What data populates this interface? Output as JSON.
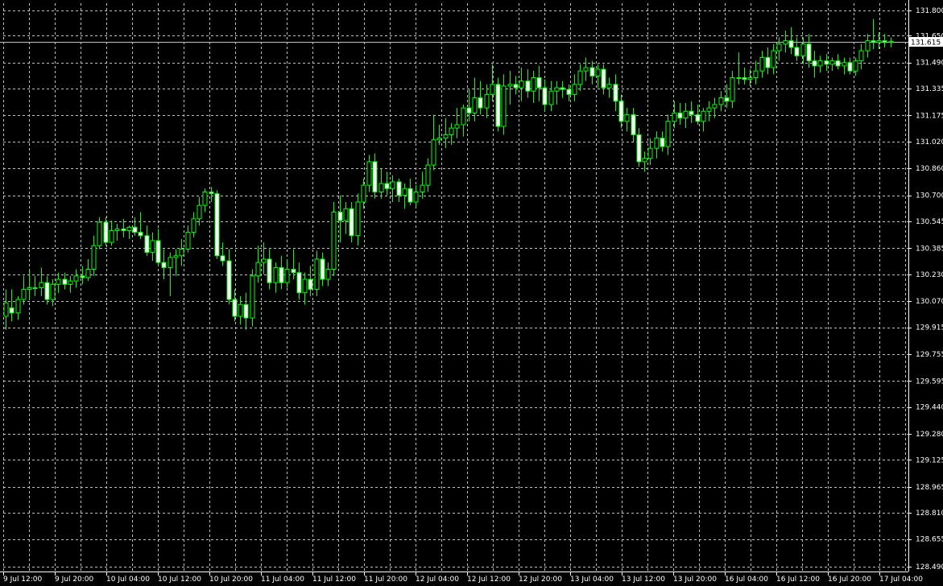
{
  "colors": {
    "background": "#000000",
    "grid": "#c0c0c0",
    "axis": "#ffffff",
    "bull_body": "#000000",
    "bull_outline": "#00ff00",
    "bear_body": "#ffffff",
    "bear_outline": "#00ff00",
    "wick": "#00ff00",
    "current_price_line": "#c0c0c0",
    "current_price_box": "#ffffff"
  },
  "chart_data": {
    "type": "candlestick",
    "grid": true,
    "ylim": [
      128.45,
      131.87
    ],
    "y_ticks": [
      "131.800",
      "131.650",
      "131.490",
      "131.335",
      "131.175",
      "131.020",
      "130.860",
      "130.700",
      "130.545",
      "130.385",
      "130.230",
      "130.070",
      "129.915",
      "129.755",
      "129.595",
      "129.440",
      "129.280",
      "129.125",
      "128.965",
      "128.810",
      "128.655",
      "128.490"
    ],
    "x_ticks": [
      "9 Jul 12:00",
      "9 Jul 20:00",
      "10 Jul 04:00",
      "10 Jul 12:00",
      "10 Jul 20:00",
      "11 Jul 04:00",
      "11 Jul 12:00",
      "11 Jul 20:00",
      "12 Jul 04:00",
      "12 Jul 12:00",
      "12 Jul 20:00",
      "13 Jul 04:00",
      "13 Jul 12:00",
      "13 Jul 20:00",
      "16 Jul 04:00",
      "16 Jul 12:00",
      "16 Jul 20:00",
      "17 Jul 04:00"
    ],
    "current_price": "131.615",
    "current_price_value": 131.615,
    "x_tick_every": 4,
    "candles": [
      {
        "o": 129.98,
        "h": 130.14,
        "l": 129.9,
        "c": 130.06
      },
      {
        "o": 130.03,
        "h": 130.14,
        "l": 129.95,
        "c": 130.0
      },
      {
        "o": 130.0,
        "h": 130.1,
        "l": 129.96,
        "c": 130.08
      },
      {
        "o": 130.08,
        "h": 130.22,
        "l": 130.05,
        "c": 130.14
      },
      {
        "o": 130.14,
        "h": 130.25,
        "l": 130.08,
        "c": 130.15
      },
      {
        "o": 130.15,
        "h": 130.22,
        "l": 130.1,
        "c": 130.15
      },
      {
        "o": 130.15,
        "h": 130.27,
        "l": 130.1,
        "c": 130.18
      },
      {
        "o": 130.18,
        "h": 130.22,
        "l": 130.05,
        "c": 130.08
      },
      {
        "o": 130.08,
        "h": 130.2,
        "l": 130.04,
        "c": 130.17
      },
      {
        "o": 130.17,
        "h": 130.24,
        "l": 130.12,
        "c": 130.2
      },
      {
        "o": 130.2,
        "h": 130.24,
        "l": 130.14,
        "c": 130.17
      },
      {
        "o": 130.17,
        "h": 130.22,
        "l": 130.12,
        "c": 130.19
      },
      {
        "o": 130.19,
        "h": 130.26,
        "l": 130.15,
        "c": 130.22
      },
      {
        "o": 130.22,
        "h": 130.28,
        "l": 130.17,
        "c": 130.21
      },
      {
        "o": 130.21,
        "h": 130.32,
        "l": 130.19,
        "c": 130.26
      },
      {
        "o": 130.26,
        "h": 130.46,
        "l": 130.22,
        "c": 130.4
      },
      {
        "o": 130.4,
        "h": 130.57,
        "l": 130.38,
        "c": 130.54
      },
      {
        "o": 130.54,
        "h": 130.57,
        "l": 130.4,
        "c": 130.42
      },
      {
        "o": 130.42,
        "h": 130.55,
        "l": 130.4,
        "c": 130.49
      },
      {
        "o": 130.49,
        "h": 130.53,
        "l": 130.43,
        "c": 130.5
      },
      {
        "o": 130.5,
        "h": 130.56,
        "l": 130.45,
        "c": 130.49
      },
      {
        "o": 130.49,
        "h": 130.52,
        "l": 130.44,
        "c": 130.51
      },
      {
        "o": 130.51,
        "h": 130.57,
        "l": 130.46,
        "c": 130.48
      },
      {
        "o": 130.48,
        "h": 130.6,
        "l": 130.44,
        "c": 130.46
      },
      {
        "o": 130.46,
        "h": 130.52,
        "l": 130.34,
        "c": 130.36
      },
      {
        "o": 130.36,
        "h": 130.48,
        "l": 130.31,
        "c": 130.43
      },
      {
        "o": 130.43,
        "h": 130.5,
        "l": 130.28,
        "c": 130.3
      },
      {
        "o": 130.3,
        "h": 130.38,
        "l": 130.2,
        "c": 130.27
      },
      {
        "o": 130.27,
        "h": 130.36,
        "l": 130.1,
        "c": 130.33
      },
      {
        "o": 130.33,
        "h": 130.38,
        "l": 130.22,
        "c": 130.34
      },
      {
        "o": 130.34,
        "h": 130.44,
        "l": 130.28,
        "c": 130.38
      },
      {
        "o": 130.38,
        "h": 130.52,
        "l": 130.36,
        "c": 130.48
      },
      {
        "o": 130.48,
        "h": 130.6,
        "l": 130.45,
        "c": 130.56
      },
      {
        "o": 130.56,
        "h": 130.69,
        "l": 130.52,
        "c": 130.64
      },
      {
        "o": 130.64,
        "h": 130.74,
        "l": 130.6,
        "c": 130.72
      },
      {
        "o": 130.72,
        "h": 130.75,
        "l": 130.66,
        "c": 130.71
      },
      {
        "o": 130.71,
        "h": 130.73,
        "l": 130.32,
        "c": 130.34
      },
      {
        "o": 130.34,
        "h": 130.42,
        "l": 130.28,
        "c": 130.31
      },
      {
        "o": 130.31,
        "h": 130.38,
        "l": 130.05,
        "c": 130.08
      },
      {
        "o": 130.08,
        "h": 130.14,
        "l": 129.95,
        "c": 129.98
      },
      {
        "o": 129.98,
        "h": 130.1,
        "l": 129.93,
        "c": 130.05
      },
      {
        "o": 130.05,
        "h": 130.12,
        "l": 129.9,
        "c": 129.97
      },
      {
        "o": 129.97,
        "h": 130.26,
        "l": 129.92,
        "c": 130.22
      },
      {
        "o": 130.22,
        "h": 130.4,
        "l": 130.18,
        "c": 130.3
      },
      {
        "o": 130.3,
        "h": 130.42,
        "l": 130.23,
        "c": 130.32
      },
      {
        "o": 130.32,
        "h": 130.38,
        "l": 130.14,
        "c": 130.18
      },
      {
        "o": 130.18,
        "h": 130.3,
        "l": 130.12,
        "c": 130.27
      },
      {
        "o": 130.27,
        "h": 130.34,
        "l": 130.14,
        "c": 130.18
      },
      {
        "o": 130.18,
        "h": 130.32,
        "l": 130.15,
        "c": 130.26
      },
      {
        "o": 130.26,
        "h": 130.38,
        "l": 130.2,
        "c": 130.24
      },
      {
        "o": 130.24,
        "h": 130.3,
        "l": 130.08,
        "c": 130.12
      },
      {
        "o": 130.12,
        "h": 130.24,
        "l": 130.05,
        "c": 130.2
      },
      {
        "o": 130.2,
        "h": 130.28,
        "l": 130.1,
        "c": 130.14
      },
      {
        "o": 130.14,
        "h": 130.37,
        "l": 130.1,
        "c": 130.32
      },
      {
        "o": 130.32,
        "h": 130.36,
        "l": 130.16,
        "c": 130.2
      },
      {
        "o": 130.2,
        "h": 130.3,
        "l": 130.16,
        "c": 130.26
      },
      {
        "o": 130.26,
        "h": 130.66,
        "l": 130.22,
        "c": 130.6
      },
      {
        "o": 130.6,
        "h": 130.7,
        "l": 130.42,
        "c": 130.55
      },
      {
        "o": 130.55,
        "h": 130.66,
        "l": 130.47,
        "c": 130.62
      },
      {
        "o": 130.62,
        "h": 130.66,
        "l": 130.42,
        "c": 130.46
      },
      {
        "o": 130.46,
        "h": 130.71,
        "l": 130.4,
        "c": 130.66
      },
      {
        "o": 130.66,
        "h": 130.8,
        "l": 130.62,
        "c": 130.76
      },
      {
        "o": 130.76,
        "h": 130.94,
        "l": 130.72,
        "c": 130.9
      },
      {
        "o": 130.9,
        "h": 130.95,
        "l": 130.68,
        "c": 130.72
      },
      {
        "o": 130.72,
        "h": 130.86,
        "l": 130.68,
        "c": 130.77
      },
      {
        "o": 130.77,
        "h": 130.84,
        "l": 130.7,
        "c": 130.74
      },
      {
        "o": 130.74,
        "h": 130.82,
        "l": 130.66,
        "c": 130.78
      },
      {
        "o": 130.78,
        "h": 130.8,
        "l": 130.66,
        "c": 130.7
      },
      {
        "o": 130.7,
        "h": 130.77,
        "l": 130.62,
        "c": 130.74
      },
      {
        "o": 130.74,
        "h": 130.8,
        "l": 130.64,
        "c": 130.66
      },
      {
        "o": 130.66,
        "h": 130.76,
        "l": 130.63,
        "c": 130.72
      },
      {
        "o": 130.72,
        "h": 130.84,
        "l": 130.68,
        "c": 130.76
      },
      {
        "o": 130.76,
        "h": 130.92,
        "l": 130.72,
        "c": 130.88
      },
      {
        "o": 130.88,
        "h": 131.18,
        "l": 130.85,
        "c": 131.03
      },
      {
        "o": 131.03,
        "h": 131.12,
        "l": 131.0,
        "c": 131.04
      },
      {
        "o": 131.04,
        "h": 131.16,
        "l": 130.98,
        "c": 131.06
      },
      {
        "o": 131.06,
        "h": 131.13,
        "l": 131.0,
        "c": 131.1
      },
      {
        "o": 131.1,
        "h": 131.22,
        "l": 131.04,
        "c": 131.12
      },
      {
        "o": 131.12,
        "h": 131.24,
        "l": 131.05,
        "c": 131.22
      },
      {
        "o": 131.22,
        "h": 131.33,
        "l": 131.14,
        "c": 131.19
      },
      {
        "o": 131.19,
        "h": 131.4,
        "l": 131.14,
        "c": 131.28
      },
      {
        "o": 131.28,
        "h": 131.38,
        "l": 131.18,
        "c": 131.22
      },
      {
        "o": 131.22,
        "h": 131.36,
        "l": 131.16,
        "c": 131.3
      },
      {
        "o": 131.3,
        "h": 131.48,
        "l": 131.26,
        "c": 131.36
      },
      {
        "o": 131.36,
        "h": 131.4,
        "l": 131.08,
        "c": 131.11
      },
      {
        "o": 131.11,
        "h": 131.42,
        "l": 131.06,
        "c": 131.35
      },
      {
        "o": 131.35,
        "h": 131.44,
        "l": 131.24,
        "c": 131.36
      },
      {
        "o": 131.36,
        "h": 131.41,
        "l": 131.3,
        "c": 131.34
      },
      {
        "o": 131.34,
        "h": 131.46,
        "l": 131.26,
        "c": 131.38
      },
      {
        "o": 131.38,
        "h": 131.45,
        "l": 131.28,
        "c": 131.32
      },
      {
        "o": 131.32,
        "h": 131.44,
        "l": 131.25,
        "c": 131.4
      },
      {
        "o": 131.4,
        "h": 131.47,
        "l": 131.26,
        "c": 131.34
      },
      {
        "o": 131.34,
        "h": 131.39,
        "l": 131.2,
        "c": 131.24
      },
      {
        "o": 131.24,
        "h": 131.38,
        "l": 131.2,
        "c": 131.32
      },
      {
        "o": 131.32,
        "h": 131.38,
        "l": 131.24,
        "c": 131.34
      },
      {
        "o": 131.34,
        "h": 131.38,
        "l": 131.28,
        "c": 131.33
      },
      {
        "o": 131.33,
        "h": 131.36,
        "l": 131.26,
        "c": 131.3
      },
      {
        "o": 131.3,
        "h": 131.42,
        "l": 131.26,
        "c": 131.36
      },
      {
        "o": 131.36,
        "h": 131.48,
        "l": 131.32,
        "c": 131.44
      },
      {
        "o": 131.44,
        "h": 131.52,
        "l": 131.38,
        "c": 131.46
      },
      {
        "o": 131.46,
        "h": 131.5,
        "l": 131.36,
        "c": 131.41
      },
      {
        "o": 131.41,
        "h": 131.48,
        "l": 131.34,
        "c": 131.45
      },
      {
        "o": 131.45,
        "h": 131.48,
        "l": 131.3,
        "c": 131.34
      },
      {
        "o": 131.34,
        "h": 131.4,
        "l": 131.28,
        "c": 131.36
      },
      {
        "o": 131.36,
        "h": 131.42,
        "l": 131.2,
        "c": 131.26
      },
      {
        "o": 131.26,
        "h": 131.3,
        "l": 131.1,
        "c": 131.14
      },
      {
        "o": 131.14,
        "h": 131.22,
        "l": 131.08,
        "c": 131.18
      },
      {
        "o": 131.18,
        "h": 131.22,
        "l": 131.02,
        "c": 131.06
      },
      {
        "o": 131.06,
        "h": 131.1,
        "l": 130.87,
        "c": 130.9
      },
      {
        "o": 130.9,
        "h": 130.96,
        "l": 130.84,
        "c": 130.92
      },
      {
        "o": 130.92,
        "h": 131.04,
        "l": 130.88,
        "c": 130.98
      },
      {
        "o": 130.98,
        "h": 131.08,
        "l": 130.92,
        "c": 131.04
      },
      {
        "o": 131.04,
        "h": 131.08,
        "l": 130.96,
        "c": 130.99
      },
      {
        "o": 130.99,
        "h": 131.18,
        "l": 130.94,
        "c": 131.14
      },
      {
        "o": 131.14,
        "h": 131.26,
        "l": 131.1,
        "c": 131.19
      },
      {
        "o": 131.19,
        "h": 131.25,
        "l": 131.12,
        "c": 131.16
      },
      {
        "o": 131.16,
        "h": 131.25,
        "l": 131.1,
        "c": 131.2
      },
      {
        "o": 131.2,
        "h": 131.26,
        "l": 131.13,
        "c": 131.18
      },
      {
        "o": 131.18,
        "h": 131.24,
        "l": 131.12,
        "c": 131.14
      },
      {
        "o": 131.14,
        "h": 131.22,
        "l": 131.08,
        "c": 131.2
      },
      {
        "o": 131.2,
        "h": 131.26,
        "l": 131.14,
        "c": 131.22
      },
      {
        "o": 131.22,
        "h": 131.28,
        "l": 131.16,
        "c": 131.24
      },
      {
        "o": 131.24,
        "h": 131.32,
        "l": 131.2,
        "c": 131.28
      },
      {
        "o": 131.28,
        "h": 131.36,
        "l": 131.22,
        "c": 131.26
      },
      {
        "o": 131.26,
        "h": 131.44,
        "l": 131.22,
        "c": 131.4
      },
      {
        "o": 131.4,
        "h": 131.55,
        "l": 131.36,
        "c": 131.4
      },
      {
        "o": 131.4,
        "h": 131.46,
        "l": 131.36,
        "c": 131.39
      },
      {
        "o": 131.39,
        "h": 131.45,
        "l": 131.35,
        "c": 131.4
      },
      {
        "o": 131.4,
        "h": 131.5,
        "l": 131.36,
        "c": 131.44
      },
      {
        "o": 131.44,
        "h": 131.56,
        "l": 131.4,
        "c": 131.52
      },
      {
        "o": 131.52,
        "h": 131.58,
        "l": 131.42,
        "c": 131.46
      },
      {
        "o": 131.46,
        "h": 131.6,
        "l": 131.42,
        "c": 131.56
      },
      {
        "o": 131.56,
        "h": 131.64,
        "l": 131.5,
        "c": 131.6
      },
      {
        "o": 131.6,
        "h": 131.68,
        "l": 131.55,
        "c": 131.62
      },
      {
        "o": 131.62,
        "h": 131.7,
        "l": 131.54,
        "c": 131.58
      },
      {
        "o": 131.58,
        "h": 131.64,
        "l": 131.5,
        "c": 131.53
      },
      {
        "o": 131.53,
        "h": 131.64,
        "l": 131.48,
        "c": 131.6
      },
      {
        "o": 131.6,
        "h": 131.66,
        "l": 131.46,
        "c": 131.5
      },
      {
        "o": 131.5,
        "h": 131.56,
        "l": 131.4,
        "c": 131.47
      },
      {
        "o": 131.47,
        "h": 131.53,
        "l": 131.43,
        "c": 131.5
      },
      {
        "o": 131.5,
        "h": 131.54,
        "l": 131.44,
        "c": 131.48
      },
      {
        "o": 131.48,
        "h": 131.52,
        "l": 131.44,
        "c": 131.5
      },
      {
        "o": 131.5,
        "h": 131.54,
        "l": 131.45,
        "c": 131.47
      },
      {
        "o": 131.47,
        "h": 131.52,
        "l": 131.42,
        "c": 131.49
      },
      {
        "o": 131.49,
        "h": 131.52,
        "l": 131.42,
        "c": 131.44
      },
      {
        "o": 131.44,
        "h": 131.52,
        "l": 131.41,
        "c": 131.5
      },
      {
        "o": 131.5,
        "h": 131.6,
        "l": 131.45,
        "c": 131.56
      },
      {
        "o": 131.56,
        "h": 131.66,
        "l": 131.52,
        "c": 131.62
      },
      {
        "o": 131.62,
        "h": 131.75,
        "l": 131.57,
        "c": 131.61
      },
      {
        "o": 131.61,
        "h": 131.67,
        "l": 131.57,
        "c": 131.62
      },
      {
        "o": 131.62,
        "h": 131.66,
        "l": 131.58,
        "c": 131.61
      },
      {
        "o": 131.61,
        "h": 131.64,
        "l": 131.58,
        "c": 131.615
      }
    ]
  }
}
